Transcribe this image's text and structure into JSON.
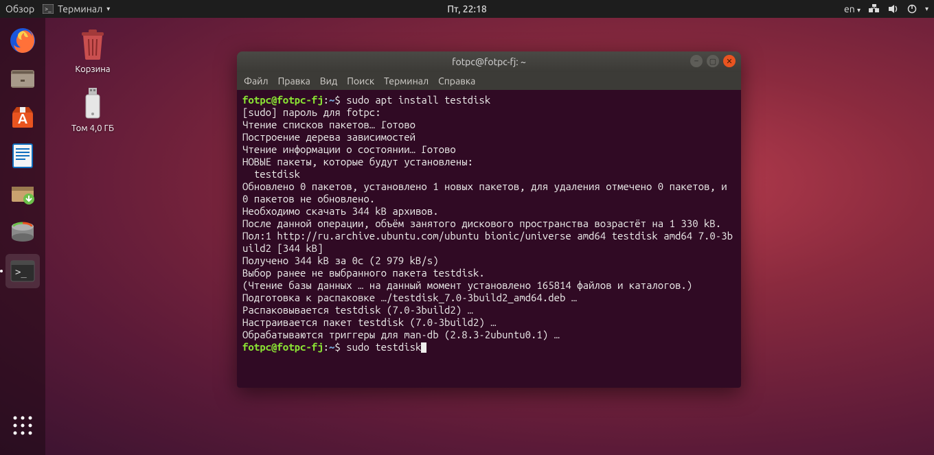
{
  "topbar": {
    "activities": "Обзор",
    "app_menu": "Терминал",
    "clock": "Пт, 22:18",
    "lang": "en"
  },
  "desktop": {
    "trash_label": "Корзина",
    "volume_label": "Том 4,0 ГБ"
  },
  "window": {
    "title": "fotpc@fotpc-fj: ~",
    "menu": {
      "file": "Файл",
      "edit": "Правка",
      "view": "Вид",
      "find": "Поиск",
      "terminal": "Терминал",
      "help": "Справка"
    }
  },
  "terminal": {
    "prompt_user": "fotpc@fotpc-fj",
    "prompt_sep": ":",
    "prompt_path": "~",
    "prompt_dollar": "$",
    "cmd1": " sudo apt install testdisk",
    "cmd2": " sudo testdisk",
    "lines": [
      "[sudo] пароль для fotpc:",
      "Чтение списков пакетов… Готово",
      "Построение дерева зависимостей",
      "Чтение информации о состоянии… Готово",
      "НОВЫЕ пакеты, которые будут установлены:",
      "  testdisk",
      "Обновлено 0 пакетов, установлено 1 новых пакетов, для удаления отмечено 0 пакетов, и 0 пакетов не обновлено.",
      "Необходимо скачать 344 kB архивов.",
      "После данной операции, объём занятого дискового пространства возрастёт на 1 330 kB.",
      "Пол:1 http://ru.archive.ubuntu.com/ubuntu bionic/universe amd64 testdisk amd64 7.0-3build2 [344 kB]",
      "Получено 344 kB за 0с (2 979 kB/s)",
      "Выбор ранее не выбранного пакета testdisk.",
      "(Чтение базы данных … на данный момент установлено 165814 файлов и каталогов.)",
      "Подготовка к распаковке …/testdisk_7.0-3build2_amd64.deb …",
      "Распаковывается testdisk (7.0-3build2) …",
      "Настраивается пакет testdisk (7.0-3build2) …",
      "Обрабатываются триггеры для man-db (2.8.3-2ubuntu0.1) …"
    ]
  }
}
